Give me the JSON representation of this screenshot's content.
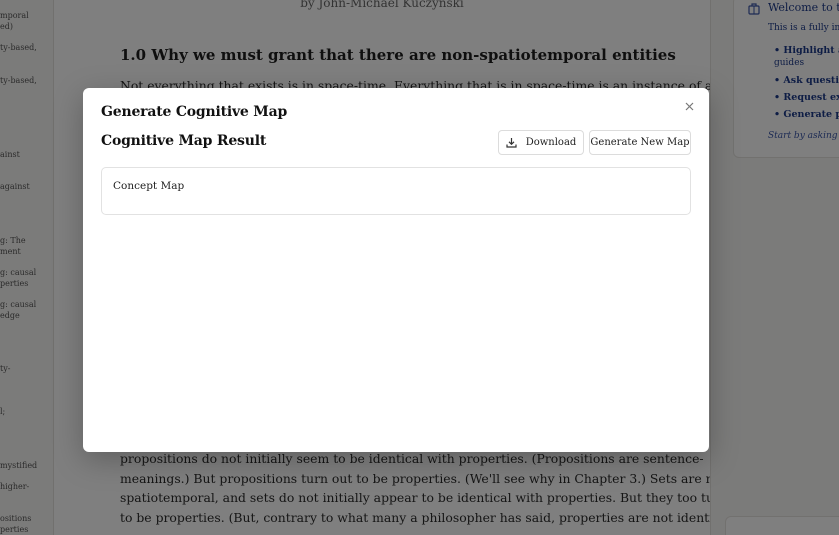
{
  "left_sidebar": {
    "items": [
      "mporal",
      "ed)",
      "ty-based,",
      "ty-based,",
      "ainst",
      "against",
      "g: The",
      "ment",
      "g: causal",
      "perties",
      "g: causal",
      "edge",
      "ty-",
      "l;",
      "mystified",
      "higher-",
      "ositions",
      "perties"
    ]
  },
  "reader": {
    "author": "by John-Michael Kuczynski",
    "section_heading": "1.0 Why we must grant that there are non-spatiotemporal entities",
    "top_line": "Not everything that exists is in space-time. Everything that is in space-time is an instance of at least",
    "lines": [
      "propositions do not initially seem to be identical with properties. (Propositions are sentence-",
      "meanings.) But propositions turn out to be properties. (We'll see why in Chapter 3.) Sets are not",
      "spatiotemporal, and sets do not initially appear to be identical with properties. But they too turn out",
      "to be properties. (But, contrary to what many a philosopher has said, properties are not identical with"
    ]
  },
  "chat": {
    "title": "Welcome to the",
    "intro": "This is a fully int",
    "bullets": [
      "• Highlight an",
      "• Ask questio",
      "• Request exp",
      "• Generate pr"
    ],
    "bullet_continuation": "guides",
    "hint": "Start by asking a",
    "icon": "book-icon"
  },
  "modal": {
    "title": "Generate Cognitive Map",
    "result_title": "Cognitive Map Result",
    "download_label": "Download",
    "new_map_label": "Generate New Map",
    "concept_label": "Concept Map",
    "close_icon": "close-icon",
    "download_icon": "download-icon"
  },
  "colors": {
    "overlay": "rgba(0,0,0,0.5)",
    "chat_text": "#1d3a8a",
    "modal_bg": "#ffffff"
  }
}
